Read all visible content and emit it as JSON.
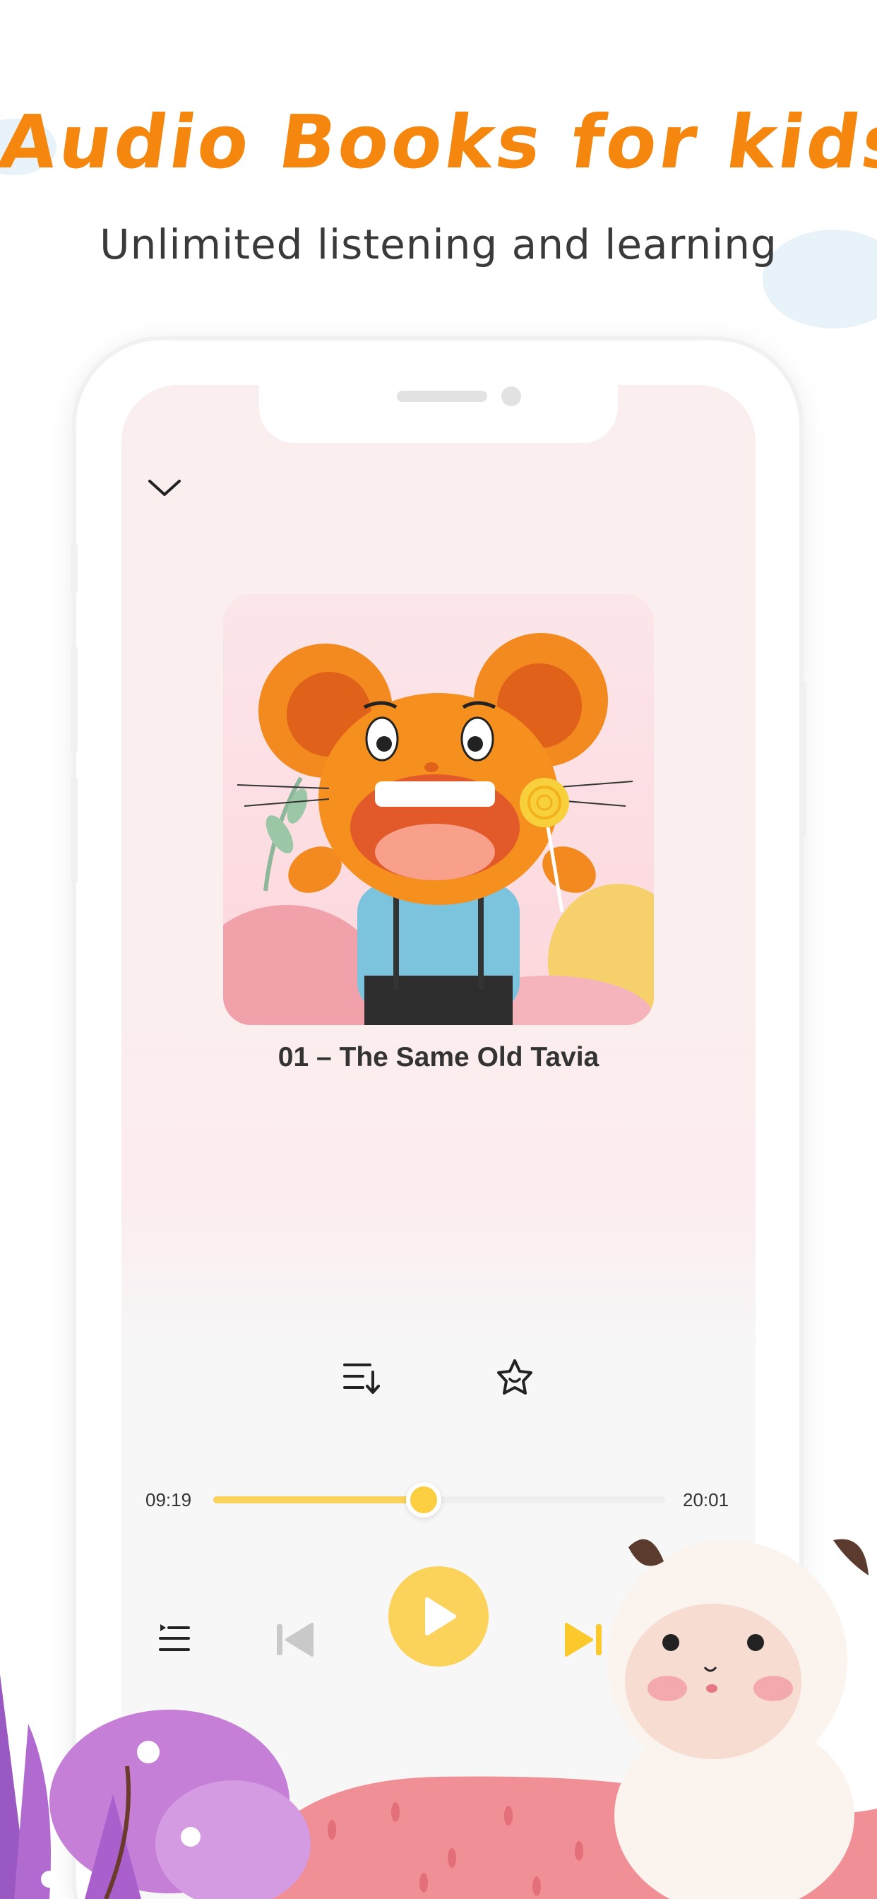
{
  "banner": {
    "headline": "Audio Books for kids",
    "subheadline": "Unlimited listening and learning"
  },
  "player": {
    "track_title": "01 – The Same Old Tavia",
    "elapsed_time": "09:19",
    "total_time": "20:01",
    "progress_fraction": 0.465
  },
  "icons": {
    "collapse": "chevron-down-icon",
    "sort": "sort-list-icon",
    "favorite": "star-face-icon",
    "playlist": "playlist-icon",
    "previous": "skip-previous-icon",
    "play": "play-icon",
    "next": "skip-next-icon"
  },
  "colors": {
    "brand_orange": "#f6870e",
    "accent_yellow": "#fbd25a",
    "text_dark": "#333333"
  }
}
